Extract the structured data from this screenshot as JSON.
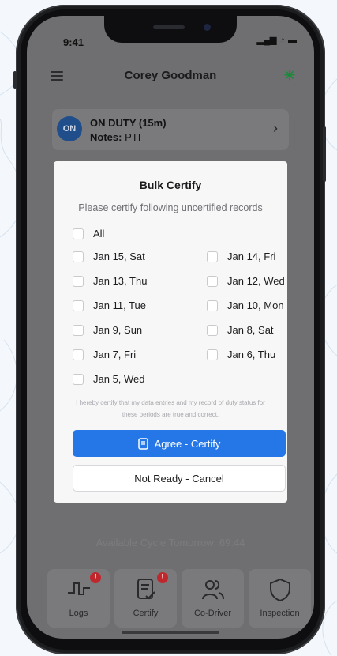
{
  "status_bar": {
    "time": "9:41",
    "signal": "▂▄▆",
    "wifi": "◔",
    "battery": "▬"
  },
  "header": {
    "title": "Corey Goodman",
    "menu_icon": "hamburger-icon",
    "bluetooth_icon": "bluetooth-icon",
    "bluetooth_glyph": "✳"
  },
  "duty": {
    "badge": "ON",
    "status": "ON DUTY (15m)",
    "notes_label": "Notes:",
    "notes_value": "PTI",
    "chevron": "›"
  },
  "modal": {
    "title": "Bulk Certify",
    "subtitle": "Please certify following uncertified records",
    "all_label": "All",
    "dates_left": [
      "Jan 15, Sat",
      "Jan 13, Thu",
      "Jan 11, Tue",
      "Jan 9, Sun",
      "Jan 7, Fri",
      "Jan 5, Wed"
    ],
    "dates_right": [
      "Jan 14, Fri",
      "Jan 12, Wed",
      "Jan 10, Mon",
      "Jan 8, Sat",
      "Jan 6, Thu"
    ],
    "disclaimer": "I hereby certify that my data entries and my record of duty status for these periods are true and correct.",
    "agree_label": "Agree - Certify",
    "cancel_label": "Not Ready - Cancel"
  },
  "cycle_text": "Available Cycle Tomorrow: 69:44",
  "tabs": [
    {
      "label": "Logs",
      "icon": "logs-icon",
      "badge": "!"
    },
    {
      "label": "Certify",
      "icon": "certify-icon",
      "badge": "!"
    },
    {
      "label": "Co-Driver",
      "icon": "co-driver-icon",
      "badge": ""
    },
    {
      "label": "Inspection",
      "icon": "shield-icon",
      "badge": ""
    }
  ],
  "colors": {
    "primary": "#2577e8",
    "badge_red": "#c0272d",
    "duty_blue": "#1f4e8a",
    "bluetooth_green": "#1a8a3a"
  }
}
